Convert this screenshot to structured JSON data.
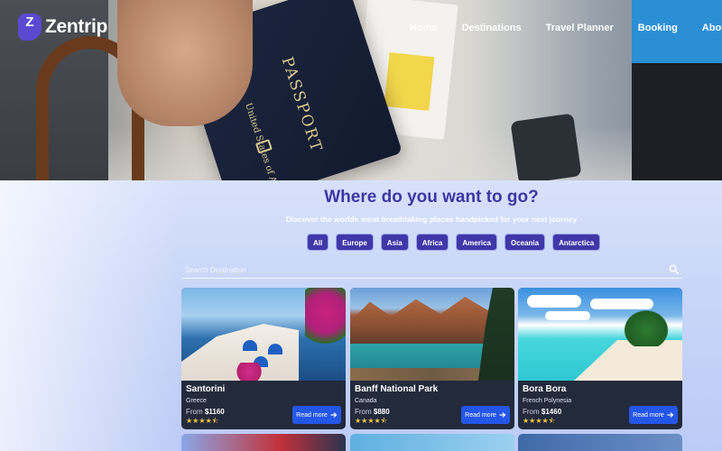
{
  "brand": {
    "mark": "Z",
    "name": "Zentrip"
  },
  "nav": [
    "Home",
    "Destinations",
    "Travel Planner",
    "Booking",
    "About Us"
  ],
  "hero": {
    "passport_title": "PASSPORT",
    "passport_country": "United States of America"
  },
  "section": {
    "title": "Where do you want to go?",
    "subtitle": "Discover the worlds most breathtaking places handpicked for your next journey"
  },
  "filters": [
    "All",
    "Europe",
    "Asia",
    "Africa",
    "America",
    "Oceania",
    "Antarctica"
  ],
  "search": {
    "placeholder": "Search Destination"
  },
  "cards": [
    {
      "name": "Santorini",
      "country": "Greece",
      "price_prefix": "From",
      "price": "$1160",
      "stars": "★★★★⯪",
      "button": "Read more"
    },
    {
      "name": "Banff National Park",
      "country": "Canada",
      "price_prefix": "From",
      "price": "$880",
      "stars": "★★★★⯪",
      "button": "Read more"
    },
    {
      "name": "Bora Bora",
      "country": "French Polynesia",
      "price_prefix": "From",
      "price": "$1460",
      "stars": "★★★★⯪",
      "button": "Read more"
    }
  ],
  "colors": {
    "accent": "#4037a8",
    "button": "#2456e8",
    "card": "#232a3c",
    "title": "#3d36a3",
    "star": "#f5c443"
  }
}
